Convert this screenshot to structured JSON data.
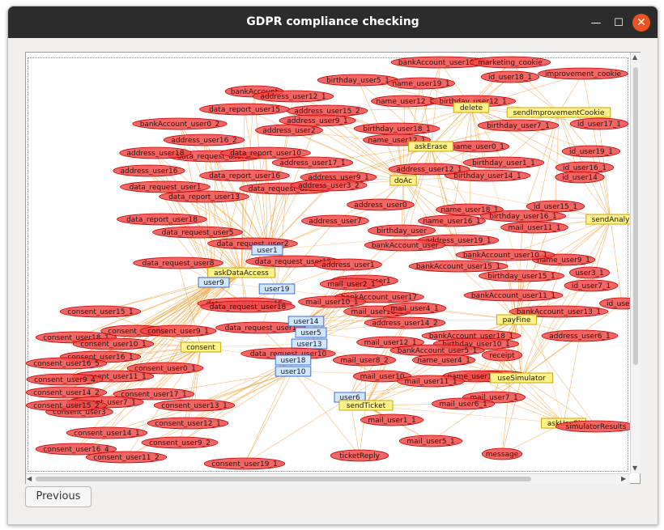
{
  "window": {
    "title": "GDPR compliance checking"
  },
  "graph": {
    "nodes": [
      {
        "label": "bankAccount_user19_1",
        "kind": "data"
      },
      {
        "label": "marketing_cookie",
        "kind": "data"
      },
      {
        "label": "improvement_cookie",
        "kind": "data"
      },
      {
        "label": "id_user18_1",
        "kind": "data"
      },
      {
        "label": "birthday_user5_1",
        "kind": "data"
      },
      {
        "label": "name_user19_1",
        "kind": "data"
      },
      {
        "label": "bankAccount",
        "kind": "data"
      },
      {
        "label": "address_user12_1",
        "kind": "data"
      },
      {
        "label": "name_user12_1",
        "kind": "data"
      },
      {
        "label": "birthday_user12_1",
        "kind": "data"
      },
      {
        "label": "address_user15_2",
        "kind": "data"
      },
      {
        "label": "delete",
        "kind": "action"
      },
      {
        "label": "sendImprovementCookie",
        "kind": "action"
      },
      {
        "label": "data_report_user15",
        "kind": "data"
      },
      {
        "label": "bankAccount_user0_2",
        "kind": "data"
      },
      {
        "label": "address_user2",
        "kind": "data"
      },
      {
        "label": "birthday_user18_1",
        "kind": "data"
      },
      {
        "label": "address_user9_1",
        "kind": "data"
      },
      {
        "label": "birthday_user7_1",
        "kind": "data"
      },
      {
        "label": "id_user17_1",
        "kind": "data"
      },
      {
        "label": "address_user16_2",
        "kind": "data"
      },
      {
        "label": "data_request_user16",
        "kind": "data"
      },
      {
        "label": "name_user12_1",
        "kind": "data"
      },
      {
        "label": "name_user0_1",
        "kind": "data"
      },
      {
        "label": "askErase",
        "kind": "action"
      },
      {
        "label": "id_user19_1",
        "kind": "data"
      },
      {
        "label": "data_report_user10",
        "kind": "data"
      },
      {
        "label": "address_user17_1",
        "kind": "data"
      },
      {
        "label": "address_user16",
        "kind": "data"
      },
      {
        "label": "address_user18",
        "kind": "data"
      },
      {
        "label": "birthday_user1_1",
        "kind": "data"
      },
      {
        "label": "id_user16_1",
        "kind": "data"
      },
      {
        "label": "data_report_user16",
        "kind": "data"
      },
      {
        "label": "address_user9_1",
        "kind": "data"
      },
      {
        "label": "doAc",
        "kind": "action"
      },
      {
        "label": "birthday_user14_1",
        "kind": "data"
      },
      {
        "label": "data_request_user12",
        "kind": "data"
      },
      {
        "label": "data_report_user13",
        "kind": "data"
      },
      {
        "label": "address_user12_1",
        "kind": "data"
      },
      {
        "label": "address_user3_2",
        "kind": "data"
      },
      {
        "label": "id_user14",
        "kind": "data"
      },
      {
        "label": "data_request_user1",
        "kind": "data"
      },
      {
        "label": "address_user0",
        "kind": "data"
      },
      {
        "label": "name_user18_1",
        "kind": "data"
      },
      {
        "label": "id_user15_1",
        "kind": "data"
      },
      {
        "label": "data_report_user18",
        "kind": "data"
      },
      {
        "label": "data_request_user5",
        "kind": "data"
      },
      {
        "label": "address_user7",
        "kind": "data"
      },
      {
        "label": "name_user16_1",
        "kind": "data"
      },
      {
        "label": "birthday_user16_1",
        "kind": "data"
      },
      {
        "label": "sendAnaly",
        "kind": "action"
      },
      {
        "label": "mail_user11_1",
        "kind": "data"
      },
      {
        "label": "data_request_user2",
        "kind": "data"
      },
      {
        "label": "birthday_user",
        "kind": "data"
      },
      {
        "label": "address_user19_1",
        "kind": "data"
      },
      {
        "label": "user1",
        "kind": "user"
      },
      {
        "label": "data_request_user8",
        "kind": "data"
      },
      {
        "label": "data_request_user19",
        "kind": "data"
      },
      {
        "label": "bankAccount_user",
        "kind": "data"
      },
      {
        "label": "address_user1",
        "kind": "data"
      },
      {
        "label": "bankAccount_user15_1",
        "kind": "data"
      },
      {
        "label": "name_user9_1",
        "kind": "data"
      },
      {
        "label": "askDataAccess",
        "kind": "action"
      },
      {
        "label": "user3_1",
        "kind": "data"
      },
      {
        "label": "birthday_user15_1",
        "kind": "data"
      },
      {
        "label": "user9",
        "kind": "user"
      },
      {
        "label": "address_user1",
        "kind": "data"
      },
      {
        "label": "bankAccount_user10_1",
        "kind": "data"
      },
      {
        "label": "id_user7_1",
        "kind": "data"
      },
      {
        "label": "user19",
        "kind": "user"
      },
      {
        "label": "mail_user2_1",
        "kind": "data"
      },
      {
        "label": "bankAccount_user17",
        "kind": "data"
      },
      {
        "label": "bankAccount_user11_1",
        "kind": "data"
      },
      {
        "label": "data_request_user15",
        "kind": "data"
      },
      {
        "label": "mail_user10_1",
        "kind": "data"
      },
      {
        "label": "id_user0",
        "kind": "data"
      },
      {
        "label": "data_request_user18",
        "kind": "data"
      },
      {
        "label": "consent_user15_1",
        "kind": "data"
      },
      {
        "label": "mail_user18_1",
        "kind": "data"
      },
      {
        "label": "mail_user4_1",
        "kind": "data"
      },
      {
        "label": "bankAccount_user13_1",
        "kind": "data"
      },
      {
        "label": "payFine",
        "kind": "action"
      },
      {
        "label": "address_user14_2",
        "kind": "data"
      },
      {
        "label": "data_request_user1",
        "kind": "data"
      },
      {
        "label": "user14",
        "kind": "user"
      },
      {
        "label": "user5",
        "kind": "user"
      },
      {
        "label": "consent_user5",
        "kind": "data"
      },
      {
        "label": "consent_user9_1",
        "kind": "data"
      },
      {
        "label": "consent_user18_1",
        "kind": "data"
      },
      {
        "label": "bankAccount_user18_1",
        "kind": "data"
      },
      {
        "label": "address_user6_1",
        "kind": "data"
      },
      {
        "label": "user13",
        "kind": "user"
      },
      {
        "label": "consent_user10_1",
        "kind": "data"
      },
      {
        "label": "consent",
        "kind": "action"
      },
      {
        "label": "mail_user12_1",
        "kind": "data"
      },
      {
        "label": "birthday_user10_1",
        "kind": "data"
      },
      {
        "label": "bankAccount_user5_1",
        "kind": "data"
      },
      {
        "label": "consent_user16_1",
        "kind": "data"
      },
      {
        "label": "data_request_user10",
        "kind": "data"
      },
      {
        "label": "user18",
        "kind": "user"
      },
      {
        "label": "mail_user13_1",
        "kind": "data"
      },
      {
        "label": "receipt",
        "kind": "data"
      },
      {
        "label": "consent_user16_5",
        "kind": "data"
      },
      {
        "label": "user10",
        "kind": "user"
      },
      {
        "label": "mail_user8_2",
        "kind": "data"
      },
      {
        "label": "name_user4_1",
        "kind": "data"
      },
      {
        "label": "consent_user0_1",
        "kind": "data"
      },
      {
        "label": "consent_user11_1",
        "kind": "data"
      },
      {
        "label": "consent_user9_4",
        "kind": "data"
      },
      {
        "label": "mail_user10",
        "kind": "data"
      },
      {
        "label": "name_user13_1",
        "kind": "data"
      },
      {
        "label": "useSimulator",
        "kind": "action"
      },
      {
        "label": "mail_user11_1",
        "kind": "data"
      },
      {
        "label": "mail_user7_1",
        "kind": "data"
      },
      {
        "label": "consent_user14_2",
        "kind": "data"
      },
      {
        "label": "consent_user17_1",
        "kind": "data"
      },
      {
        "label": "consent_user7_1",
        "kind": "data"
      },
      {
        "label": "user6",
        "kind": "user"
      },
      {
        "label": "sendTicket",
        "kind": "action"
      },
      {
        "label": "mail_user6_1",
        "kind": "data"
      },
      {
        "label": "consent_user3",
        "kind": "data"
      },
      {
        "label": "consent_user15_2",
        "kind": "data"
      },
      {
        "label": "consent_user13_1",
        "kind": "data"
      },
      {
        "label": "mail_user1_1",
        "kind": "data"
      },
      {
        "label": "askUseSi",
        "kind": "action"
      },
      {
        "label": "simulatorResults",
        "kind": "data"
      },
      {
        "label": "consent_user12_1",
        "kind": "data"
      },
      {
        "label": "consent_user14_1",
        "kind": "data"
      },
      {
        "label": "consent_user9_2",
        "kind": "data"
      },
      {
        "label": "consent_user16_4",
        "kind": "data"
      },
      {
        "label": "mail_user5_1",
        "kind": "data"
      },
      {
        "label": "ticketReply",
        "kind": "data"
      },
      {
        "label": "message",
        "kind": "data"
      },
      {
        "label": "consent_user11_2",
        "kind": "data"
      },
      {
        "label": "consent_user19_1",
        "kind": "data"
      }
    ]
  },
  "footer": {
    "previous_label": "Previous"
  },
  "colors": {
    "node_fill": "#f14b4b",
    "node_stroke": "#c40000",
    "edge": "#f3a23a",
    "action_fill": "#fff28c",
    "user_fill": "#d2e6ff"
  }
}
